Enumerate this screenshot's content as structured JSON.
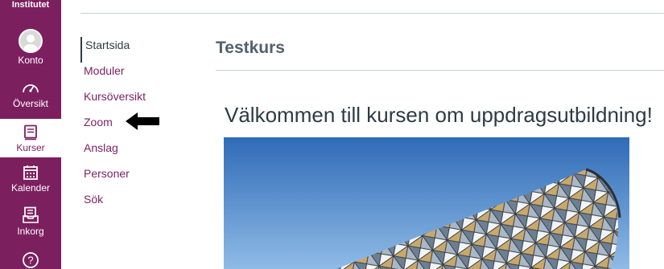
{
  "global_nav": {
    "brand": "Institutet",
    "items": [
      {
        "label": "Konto",
        "icon": "account-avatar-icon"
      },
      {
        "label": "Översikt",
        "icon": "dashboard-icon"
      },
      {
        "label": "Kurser",
        "icon": "courses-icon"
      },
      {
        "label": "Kalender",
        "icon": "calendar-icon"
      },
      {
        "label": "Inkorg",
        "icon": "inbox-icon"
      },
      {
        "label": "",
        "icon": "help-icon"
      }
    ],
    "color": "#7c1f5f"
  },
  "course_nav": {
    "items": [
      {
        "label": "Startsida"
      },
      {
        "label": "Moduler"
      },
      {
        "label": "Kursöversikt"
      },
      {
        "label": "Zoom"
      },
      {
        "label": "Anslag"
      },
      {
        "label": "Personer"
      },
      {
        "label": "Sök"
      }
    ]
  },
  "main": {
    "course_title": "Testkurs",
    "welcome_heading": "Välkommen till kursen om uppdragsutbildning!"
  },
  "annotation": {
    "icon": "left-arrow-icon"
  }
}
